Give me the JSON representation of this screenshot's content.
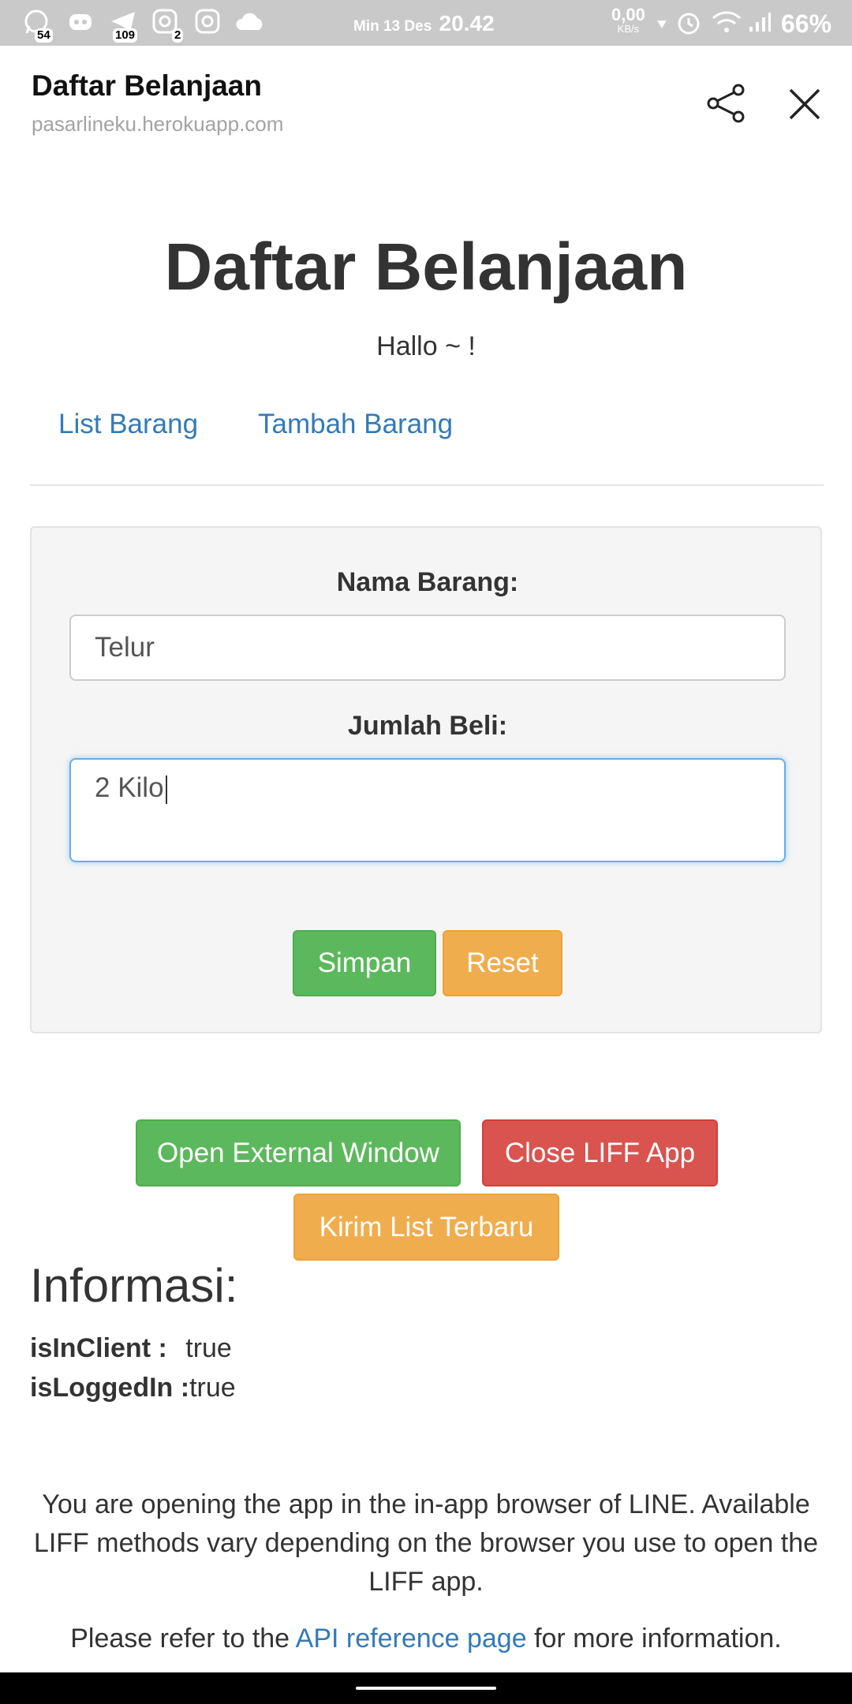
{
  "status_bar": {
    "badges": [
      "54",
      "109",
      "2"
    ],
    "date": "Min 13 Des",
    "time": "20.42",
    "net_speed": "0,00",
    "net_unit": "KB/s",
    "battery": "66%"
  },
  "header": {
    "title": "Daftar Belanjaan",
    "url": "pasarlineku.herokuapp.com"
  },
  "page": {
    "title": "Daftar Belanjaan",
    "greeting": "Hallo ~ !",
    "nav": [
      "List Barang",
      "Tambah Barang"
    ]
  },
  "form": {
    "item_label": "Nama Barang:",
    "item_value": "Telur",
    "qty_label": "Jumlah Beli:",
    "qty_value": "2 Kilo",
    "save_label": "Simpan",
    "reset_label": "Reset"
  },
  "actions": {
    "open_external": "Open External Window",
    "close_liff": "Close LIFF App",
    "send_list": "Kirim List Terbaru"
  },
  "info": {
    "title": "Informasi:",
    "rows": [
      {
        "key": "isInClient :",
        "value": "true"
      },
      {
        "key": "isLoggedIn :",
        "value": "true"
      }
    ]
  },
  "notice": {
    "line1": "You are opening the app in the in-app browser of LINE. Available LIFF methods vary depending on the browser you use to open the LIFF app.",
    "refer_prefix": "Please refer to the",
    "refer_link": "API reference page",
    "refer_suffix": "for more information."
  },
  "colors": {
    "link": "#337ab7",
    "success": "#5cb85c",
    "warning": "#f0ad4e",
    "danger": "#d9534f"
  }
}
